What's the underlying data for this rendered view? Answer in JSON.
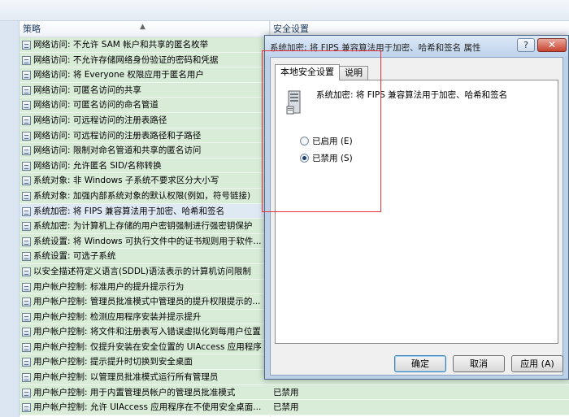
{
  "policy_list": {
    "col_policy": "策略",
    "col_setting": "安全设置",
    "rows": [
      {
        "text": "网络访问: 不允许 SAM 帐户和共享的匿名枚举",
        "setting": ""
      },
      {
        "text": "网络访问: 不允许存储网络身份验证的密码和凭据",
        "setting": ""
      },
      {
        "text": "网络访问: 将 Everyone 权限应用于匿名用户",
        "setting": ""
      },
      {
        "text": "网络访问: 可匿名访问的共享",
        "setting": ""
      },
      {
        "text": "网络访问: 可匿名访问的命名管道",
        "setting": ""
      },
      {
        "text": "网络访问: 可远程访问的注册表路径",
        "setting": ""
      },
      {
        "text": "网络访问: 可远程访问的注册表路径和子路径",
        "setting": ""
      },
      {
        "text": "网络访问: 限制对命名管道和共享的匿名访问",
        "setting": ""
      },
      {
        "text": "网络访问: 允许匿名 SID/名称转换",
        "setting": ""
      },
      {
        "text": "系统对象: 非 Windows 子系统不要求区分大小写",
        "setting": ""
      },
      {
        "text": "系统对象: 加强内部系统对象的默认权限(例如，符号链接)",
        "setting": ""
      },
      {
        "text": "系统加密: 将 FIPS 兼容算法用于加密、哈希和签名",
        "setting": "",
        "selected": true
      },
      {
        "text": "系统加密: 为计算机上存储的用户密钥强制进行强密钥保护",
        "setting": ""
      },
      {
        "text": "系统设置: 将 Windows 可执行文件中的证书规则用于软件...",
        "setting": ""
      },
      {
        "text": "系统设置: 可选子系统",
        "setting": ""
      },
      {
        "text": "以安全描述符定义语言(SDDL)语法表示的计算机访问限制",
        "setting": ""
      },
      {
        "text": "用户帐户控制: 标准用户的提升提示行为",
        "setting": ""
      },
      {
        "text": "用户帐户控制: 管理员批准模式中管理员的提升权限提示的...",
        "setting": ""
      },
      {
        "text": "用户帐户控制: 检测应用程序安装并提示提升",
        "setting": ""
      },
      {
        "text": "用户帐户控制: 将文件和注册表写入错误虚拟化到每用户位置",
        "setting": ""
      },
      {
        "text": "用户帐户控制: 仅提升安装在安全位置的 UIAccess 应用程序",
        "setting": ""
      },
      {
        "text": "用户帐户控制: 提示提升时切换到安全桌面",
        "setting": ""
      },
      {
        "text": "用户帐户控制: 以管理员批准模式运行所有管理员",
        "setting": ""
      },
      {
        "text": "用户帐户控制: 用于内置管理员帐户的管理员批准模式",
        "setting": "已禁用"
      },
      {
        "text": "用户帐户控制: 允许 UIAccess 应用程序在不使用安全桌面...",
        "setting": "已禁用"
      }
    ]
  },
  "dialog": {
    "title": "系统加密: 将 FIPS 兼容算法用于加密、哈希和签名 属性",
    "help_label": "?",
    "close_label": "✕",
    "tabs": [
      "本地安全设置",
      "说明"
    ],
    "heading": "系统加密: 将 FIPS 兼容算法用于加密、哈希和签名",
    "options": [
      {
        "label": "已启用 (E)",
        "checked": false
      },
      {
        "label": "已禁用 (S)",
        "checked": true
      }
    ],
    "ok_label": "确定",
    "cancel_label": "取消",
    "apply_label": "应用 (A)"
  },
  "colors": {
    "row_bg": "#d8ecd8",
    "annotation_red": "#e8323a",
    "close_red": "#c8432f"
  }
}
